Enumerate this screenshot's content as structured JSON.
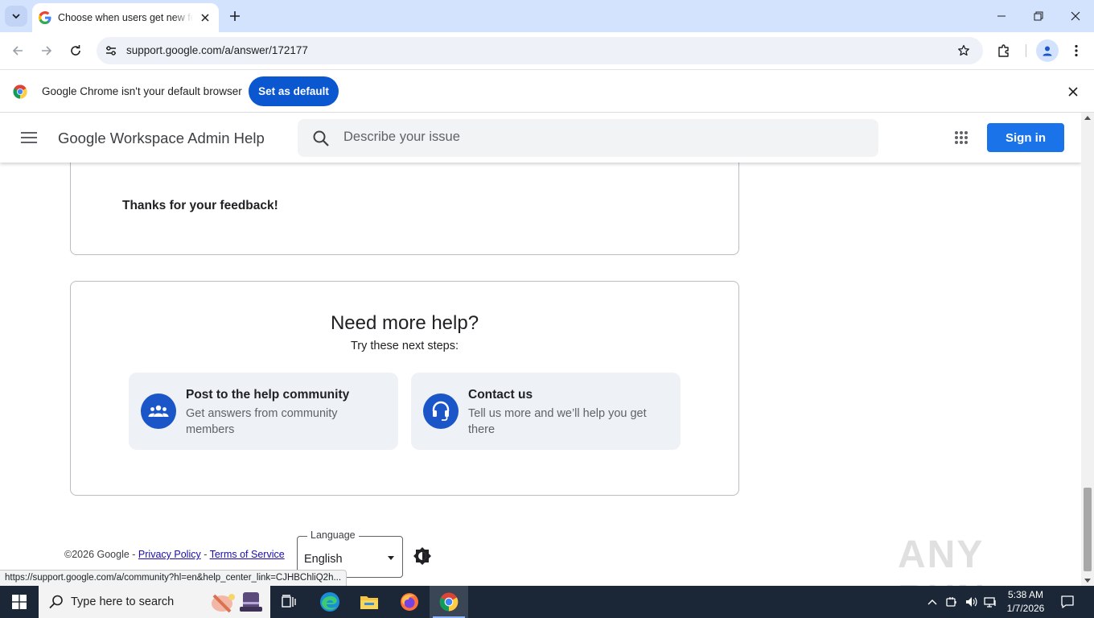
{
  "browser": {
    "tab": {
      "title": "Choose when users get new features - Google Workspace Admin Help",
      "icon": "google-g-icon"
    },
    "url": "support.google.com/a/answer/172177",
    "infobar": {
      "text": "Google Chrome isn't your default browser",
      "button": "Set as default"
    },
    "status_url": "https://support.google.com/a/community?hl=en&help_center_link=CJHBChliQ2h..."
  },
  "header": {
    "title": "Google Workspace Admin Help",
    "search_placeholder": "Describe your issue",
    "sign_in": "Sign in"
  },
  "feedback": {
    "text": "Thanks for your feedback!"
  },
  "help": {
    "title": "Need more help?",
    "subtitle": "Try these next steps:",
    "options": [
      {
        "title": "Post to the help community",
        "description": "Get answers from community members",
        "icon": "community-icon"
      },
      {
        "title": "Contact us",
        "description": "Tell us more and we’ll help you get there",
        "icon": "headset-icon"
      }
    ]
  },
  "footer": {
    "copyright": "©2026 Google",
    "sep": " - ",
    "privacy": "Privacy Policy",
    "terms": "Terms of Service",
    "language_label": "Language",
    "language_value": "English"
  },
  "watermark": "ANY RUN",
  "taskbar": {
    "search_text": "Type here to search",
    "time": "5:38 AM",
    "date": "1/7/2026"
  },
  "colors": {
    "accent": "#1a73e8",
    "chrome_button": "#0b57d0",
    "tabstrip": "#d3e3fd",
    "taskbar": "#1b2736"
  }
}
